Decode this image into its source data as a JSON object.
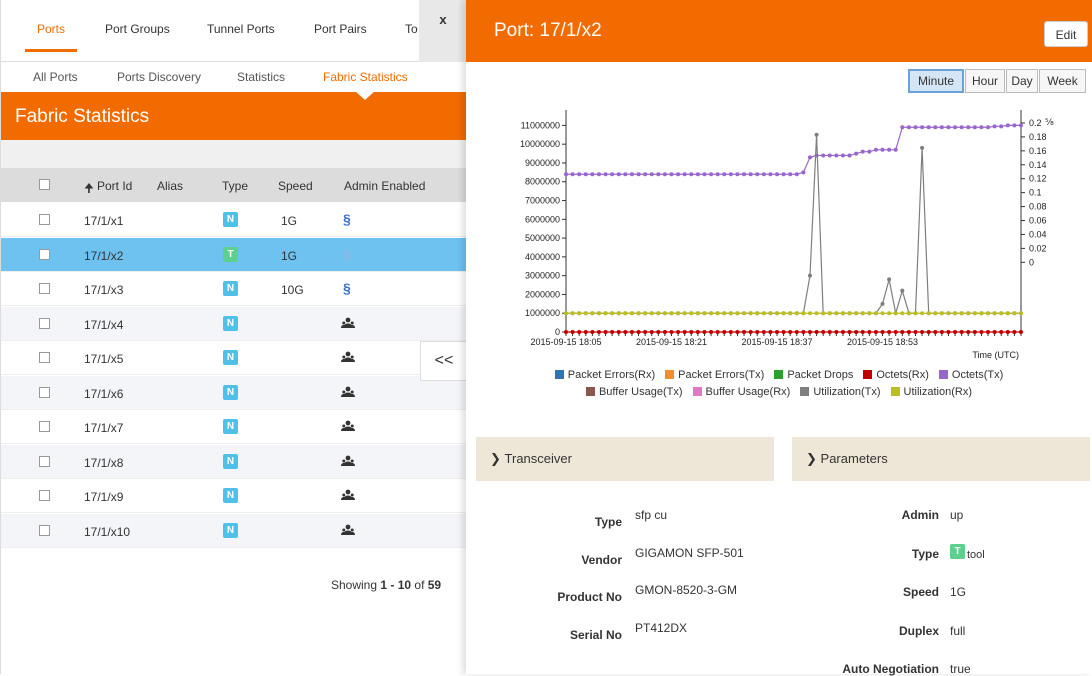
{
  "left": {
    "tabs": [
      "Ports",
      "Port Groups",
      "Tunnel Ports",
      "Port Pairs",
      "To"
    ],
    "close_label": "x",
    "subtabs": [
      "All Ports",
      "Ports Discovery",
      "Statistics",
      "Fabric Statistics"
    ],
    "banner_title": "Fabric Statistics",
    "columns": [
      "Port Id",
      "Alias",
      "Type",
      "Speed",
      "Admin Enabled"
    ],
    "rows": [
      {
        "port": "17/1/x1",
        "type": "N",
        "speed": "1G",
        "admin": "link"
      },
      {
        "port": "17/1/x2",
        "type": "T",
        "speed": "1G",
        "admin": "link"
      },
      {
        "port": "17/1/x3",
        "type": "N",
        "speed": "10G",
        "admin": "link"
      },
      {
        "port": "17/1/x4",
        "type": "N",
        "speed": "",
        "admin": "people"
      },
      {
        "port": "17/1/x5",
        "type": "N",
        "speed": "",
        "admin": "people"
      },
      {
        "port": "17/1/x6",
        "type": "N",
        "speed": "",
        "admin": "people"
      },
      {
        "port": "17/1/x7",
        "type": "N",
        "speed": "",
        "admin": "people"
      },
      {
        "port": "17/1/x8",
        "type": "N",
        "speed": "",
        "admin": "people"
      },
      {
        "port": "17/1/x9",
        "type": "N",
        "speed": "",
        "admin": "people"
      },
      {
        "port": "17/1/x10",
        "type": "N",
        "speed": "",
        "admin": "people"
      }
    ],
    "showing_prefix": "Showing ",
    "showing_range": "1 - 10",
    "showing_of": " of ",
    "showing_total": "59",
    "collapse_label": "<<"
  },
  "right": {
    "title": "Port: 17/1/x2",
    "edit_label": "Edit",
    "ranges": [
      "Minute",
      "Hour",
      "Day",
      "Week"
    ],
    "transceiver": {
      "label": "Transceiver",
      "fields": [
        {
          "k": "Type",
          "v": "sfp cu"
        },
        {
          "k": "Vendor",
          "v": "GIGAMON SFP-501"
        },
        {
          "k": "Product No",
          "v": "GMON-8520-3-GM"
        },
        {
          "k": "Serial No",
          "v": "PT412DX"
        }
      ]
    },
    "parameters": {
      "label": "Parameters",
      "fields": [
        {
          "k": "Admin",
          "v": "up"
        },
        {
          "k": "Type",
          "v": "tool",
          "badge": "T"
        },
        {
          "k": "Speed",
          "v": "1G"
        },
        {
          "k": "Duplex",
          "v": "full"
        },
        {
          "k": "Auto Negotiation",
          "v": "true"
        }
      ]
    }
  },
  "chart_data": {
    "type": "line",
    "xlabel": "Time (UTC)",
    "x_ticks": [
      "2015-09-15 18:05",
      "2015-09-15 18:21",
      "2015-09-15 18:37",
      "2015-09-15 18:53"
    ],
    "y_left_ticks": [
      "0",
      "1000000",
      "2000000",
      "3000000",
      "4000000",
      "5000000",
      "6000000",
      "7000000",
      "8000000",
      "9000000",
      "10000000",
      "11000000"
    ],
    "y_right_ticks": [
      "0",
      "0.02",
      "0.04",
      "0.06",
      "0.08",
      "0.1",
      "0.12",
      "0.14",
      "0.16",
      "0.18",
      "0.2"
    ],
    "ylim_left": [
      0,
      11500000
    ],
    "ylim_right": [
      -0.1,
      0.21
    ],
    "right_axis_glyph": "⅝",
    "series": [
      {
        "name": "Packet Errors(Rx)",
        "color": "#2e75b6",
        "axis": "left",
        "values": []
      },
      {
        "name": "Packet Errors(Tx)",
        "color": "#f28e2b",
        "axis": "left",
        "values": []
      },
      {
        "name": "Packet Drops",
        "color": "#2ca02c",
        "axis": "left",
        "values": []
      },
      {
        "name": "Octets(Rx)",
        "color": "#c00000",
        "axis": "left",
        "values": [
          0,
          0,
          0,
          0,
          0,
          0,
          0,
          0,
          0,
          0,
          0,
          0,
          0,
          0,
          0,
          0,
          0,
          0,
          0,
          0,
          0,
          0,
          0,
          0,
          0,
          0,
          0,
          0,
          0,
          0,
          0,
          0,
          0,
          0,
          0,
          0,
          0,
          0,
          0,
          0,
          0,
          0,
          0,
          0,
          0,
          0,
          0,
          0,
          0,
          0,
          0,
          0,
          0,
          0,
          0,
          0,
          0,
          0,
          0,
          0,
          0,
          0,
          0,
          0,
          0,
          0,
          0,
          0,
          0,
          0
        ]
      },
      {
        "name": "Octets(Tx)",
        "color": "#9966cc",
        "axis": "left",
        "values": [
          8400000,
          8400000,
          8400000,
          8400000,
          8400000,
          8400000,
          8400000,
          8400000,
          8400000,
          8400000,
          8400000,
          8400000,
          8400000,
          8400000,
          8400000,
          8400000,
          8400000,
          8400000,
          8400000,
          8400000,
          8400000,
          8400000,
          8400000,
          8400000,
          8400000,
          8400000,
          8400000,
          8400000,
          8400000,
          8400000,
          8400000,
          8400000,
          8400000,
          8400000,
          8400000,
          8400000,
          8500000,
          9300000,
          9400000,
          9400000,
          9400000,
          9400000,
          9400000,
          9400000,
          9500000,
          9600000,
          9600000,
          9700000,
          9700000,
          9700000,
          9700000,
          10900000,
          10900000,
          10900000,
          10900000,
          10900000,
          10900000,
          10900000,
          10900000,
          10900000,
          10900000,
          10900000,
          10900000,
          10900000,
          10900000,
          10950000,
          10950000,
          11000000,
          11000000,
          11000000
        ]
      },
      {
        "name": "Buffer Usage(Tx)",
        "color": "#8c564b",
        "axis": "left",
        "values": []
      },
      {
        "name": "Buffer Usage(Rx)",
        "color": "#e377c2",
        "axis": "left",
        "values": []
      },
      {
        "name": "Utilization(Tx)",
        "color": "#7f7f7f",
        "axis": "left",
        "values": [
          1000000,
          1000000,
          1000000,
          1000000,
          1000000,
          1000000,
          1000000,
          1000000,
          1000000,
          1000000,
          1000000,
          1000000,
          1000000,
          1000000,
          1000000,
          1000000,
          1000000,
          1000000,
          1000000,
          1000000,
          1000000,
          1000000,
          1000000,
          1000000,
          1000000,
          1000000,
          1000000,
          1000000,
          1000000,
          1000000,
          1000000,
          1000000,
          1000000,
          1000000,
          1000000,
          1000000,
          1000000,
          3000000,
          10500000,
          1000000,
          1000000,
          1000000,
          1000000,
          1000000,
          1000000,
          1000000,
          1000000,
          1000000,
          1500000,
          2800000,
          1000000,
          2200000,
          1000000,
          1000000,
          9800000,
          1000000,
          1000000,
          1000000,
          1000000,
          1000000,
          1000000,
          1000000,
          1000000,
          1000000,
          1000000,
          1000000,
          1000000,
          1000000,
          1000000,
          1000000
        ]
      },
      {
        "name": "Utilization(Rx)",
        "color": "#bcbd22",
        "axis": "left",
        "values": [
          1000000,
          1000000,
          1000000,
          1000000,
          1000000,
          1000000,
          1000000,
          1000000,
          1000000,
          1000000,
          1000000,
          1000000,
          1000000,
          1000000,
          1000000,
          1000000,
          1000000,
          1000000,
          1000000,
          1000000,
          1000000,
          1000000,
          1000000,
          1000000,
          1000000,
          1000000,
          1000000,
          1000000,
          1000000,
          1000000,
          1000000,
          1000000,
          1000000,
          1000000,
          1000000,
          1000000,
          1000000,
          1000000,
          1000000,
          1000000,
          1000000,
          1000000,
          1000000,
          1000000,
          1000000,
          1000000,
          1000000,
          1000000,
          1000000,
          1000000,
          1000000,
          1000000,
          1000000,
          1000000,
          1000000,
          1000000,
          1000000,
          1000000,
          1000000,
          1000000,
          1000000,
          1000000,
          1000000,
          1000000,
          1000000,
          1000000,
          1000000,
          1000000,
          1000000,
          1000000
        ]
      }
    ],
    "legend_rows": [
      [
        0,
        1,
        2,
        3,
        4
      ],
      [
        5,
        6,
        7,
        8
      ]
    ]
  }
}
